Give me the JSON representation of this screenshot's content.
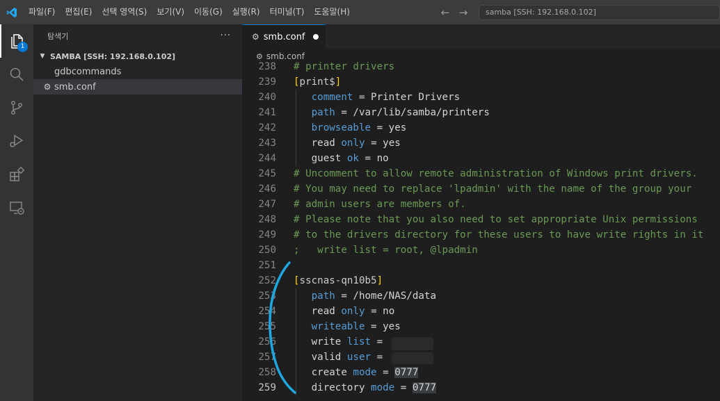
{
  "titlebar": {
    "menu": [
      "파일(F)",
      "편집(E)",
      "선택 영역(S)",
      "보기(V)",
      "이동(G)",
      "실행(R)",
      "터미널(T)",
      "도움말(H)"
    ],
    "search_text": "samba [SSH: 192.168.0.102]",
    "back_icon": "arrow-left-icon",
    "forward_icon": "arrow-right-icon"
  },
  "activitybar": {
    "explorer_badge": "1",
    "icons": [
      "files-icon",
      "search-icon",
      "source-control-icon",
      "run-debug-icon",
      "extensions-icon",
      "remote-explorer-icon"
    ]
  },
  "sidebar": {
    "title": "탐색기",
    "more": "···",
    "folder": "SAMBA [SSH: 192.168.0.102]",
    "files": [
      {
        "name": "gdbcommands",
        "selected": false
      },
      {
        "name": "smb.conf",
        "selected": true
      }
    ]
  },
  "editor": {
    "tab_label": "smb.conf",
    "breadcrumb": "smb.conf",
    "lines": [
      {
        "n": "238",
        "text": "# printer drivers"
      },
      {
        "n": "239",
        "text": "[print$]"
      },
      {
        "n": "240",
        "text": "   comment = Printer Drivers"
      },
      {
        "n": "241",
        "text": "   path = /var/lib/samba/printers"
      },
      {
        "n": "242",
        "text": "   browseable = yes"
      },
      {
        "n": "243",
        "text": "   read only = yes"
      },
      {
        "n": "244",
        "text": "   guest ok = no"
      },
      {
        "n": "245",
        "text": "# Uncomment to allow remote administration of Windows print drivers."
      },
      {
        "n": "246",
        "text": "# You may need to replace 'lpadmin' with the name of the group your"
      },
      {
        "n": "247",
        "text": "# admin users are members of."
      },
      {
        "n": "248",
        "text": "# Please note that you also need to set appropriate Unix permissions"
      },
      {
        "n": "249",
        "text": "# to the drivers directory for these users to have write rights in it"
      },
      {
        "n": "250",
        "text": ";   write list = root, @lpadmin"
      },
      {
        "n": "251",
        "text": ""
      },
      {
        "n": "252",
        "text": "[sscnas-qn10b5]"
      },
      {
        "n": "253",
        "text": "   path = /home/NAS/data"
      },
      {
        "n": "254",
        "text": "   read only = no"
      },
      {
        "n": "255",
        "text": "   writeable = yes"
      },
      {
        "n": "256",
        "text": "   write list = "
      },
      {
        "n": "257",
        "text": "   valid user = "
      },
      {
        "n": "258",
        "text": "   create mode = 0777"
      },
      {
        "n": "259",
        "text": "   directory mode = 0777"
      }
    ]
  },
  "colors": {
    "comment": "#6a9955",
    "keyword": "#569cd6",
    "bracket": "#ffd700",
    "annotation": "#1ea7e0",
    "accent": "#0078d4"
  }
}
